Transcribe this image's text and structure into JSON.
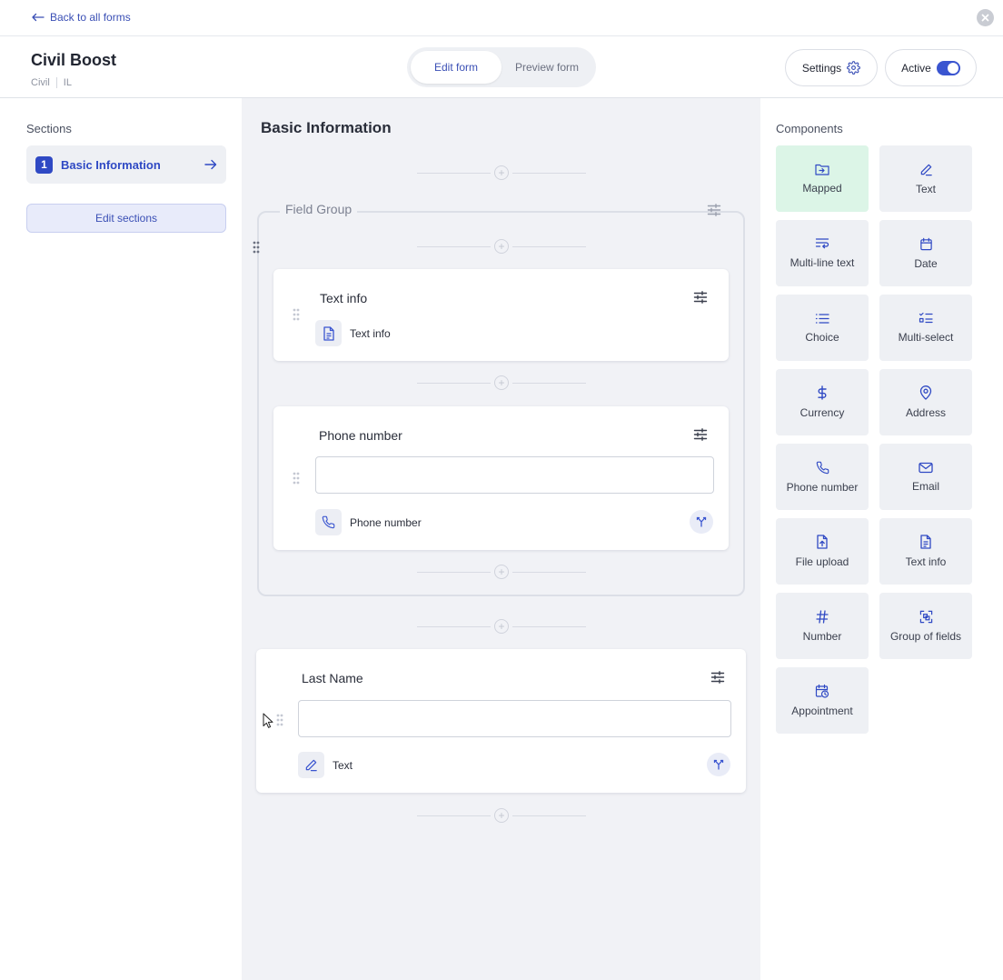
{
  "topbar": {
    "back_label": "Back to all forms"
  },
  "header": {
    "title": "Civil Boost",
    "meta": [
      "Civil",
      "IL"
    ],
    "tabs": [
      {
        "label": "Edit form",
        "active": true
      },
      {
        "label": "Preview form",
        "active": false
      }
    ],
    "settings_label": "Settings",
    "active_label": "Active",
    "active_on": true
  },
  "sections": {
    "heading": "Sections",
    "items": [
      {
        "number": "1",
        "label": "Basic Information"
      }
    ],
    "edit_label": "Edit sections"
  },
  "canvas": {
    "section_title": "Basic Information",
    "group": {
      "title": "Field Group",
      "fields": [
        {
          "title": "Text info",
          "type_label": "Text info",
          "type_icon": "document-icon"
        },
        {
          "title": "Phone number",
          "type_label": "Phone number",
          "type_icon": "phone-icon",
          "value": ""
        }
      ]
    },
    "fields": [
      {
        "title": "Last Name",
        "type_label": "Text",
        "type_icon": "pen-icon",
        "value": ""
      }
    ]
  },
  "components": {
    "heading": "Components",
    "items": [
      {
        "label": "Mapped",
        "icon": "mapped-icon"
      },
      {
        "label": "Text",
        "icon": "pen-icon"
      },
      {
        "label": "Multi-line text",
        "icon": "multiline-icon"
      },
      {
        "label": "Date",
        "icon": "calendar-icon"
      },
      {
        "label": "Choice",
        "icon": "list-icon"
      },
      {
        "label": "Multi-select",
        "icon": "checklist-icon"
      },
      {
        "label": "Currency",
        "icon": "dollar-icon"
      },
      {
        "label": "Address",
        "icon": "map-pin-icon"
      },
      {
        "label": "Phone number",
        "icon": "phone-icon"
      },
      {
        "label": "Email",
        "icon": "mail-icon"
      },
      {
        "label": "File upload",
        "icon": "file-upload-icon"
      },
      {
        "label": "Text info",
        "icon": "document-icon"
      },
      {
        "label": "Number",
        "icon": "hash-icon"
      },
      {
        "label": "Group of fields",
        "icon": "group-icon"
      },
      {
        "label": "Appointment",
        "icon": "calendar-clock-icon"
      }
    ]
  },
  "colors": {
    "accent": "#2f49c4",
    "mapped_tile": "#dcf5e7",
    "canvas_bg": "#f1f2f6"
  }
}
